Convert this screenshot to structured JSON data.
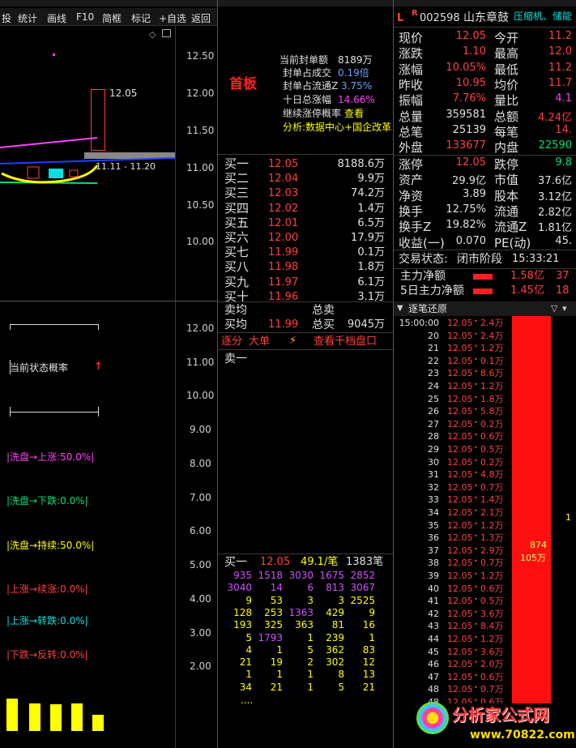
{
  "toolbar": {
    "items": [
      "投",
      "统计",
      "画线",
      "F10",
      "简框",
      "标记",
      "+自选",
      "返回"
    ]
  },
  "chart_top": {
    "y_ticks": [
      "12.50",
      "12.00",
      "11.50",
      "11.00",
      "10.50",
      "10.00"
    ],
    "price_label": "12.05",
    "range_label": "11.11 - 11.20"
  },
  "chart_bottom": {
    "y_ticks": [
      "12.00",
      "11.00",
      "10.00",
      "9.00",
      "8.00",
      "7.00",
      "6.00",
      "5.00",
      "4.00",
      "3.00",
      "2.00"
    ],
    "status_title": "当前状态概率",
    "arrow": "↑",
    "probs": [
      {
        "text": "|洗盘→上涨:50.0%|",
        "color": "#ff40ff"
      },
      {
        "text": "|洗盘→下跌:0.0%|",
        "color": "#00e070"
      },
      {
        "text": "|洗盘→持续:50.0%|",
        "color": "#ffff00"
      },
      {
        "text": "|上涨→续涨:0.0%|",
        "color": "#ff4040"
      },
      {
        "text": "|上涨→转跌:0.0%|",
        "color": "#00e0e0"
      },
      {
        "text": "|下跌→反转:0.0%|",
        "color": "#ff4040"
      }
    ]
  },
  "info": {
    "lines": [
      {
        "k": "当前封单额",
        "v": "8189万",
        "vc": "#e0e0e0"
      },
      {
        "k": "封单占成交",
        "v": "0.19倍",
        "vc": "#6ca0ff"
      },
      {
        "k": "封单占流通Z",
        "v": "3.75%",
        "vc": "#6ca0ff"
      },
      {
        "k": "十日总涨幅",
        "v": "14.66%",
        "vc": "#ff40ff"
      },
      {
        "k": "继续涨停概率",
        "v": "查看",
        "vc": "#ffff00"
      }
    ],
    "analysis": "分析:数据中心+国企改革",
    "badge": "首板"
  },
  "orderbook": {
    "bids": [
      [
        "买一",
        "12.05",
        "8188.6万"
      ],
      [
        "买二",
        "12.04",
        "9.9万"
      ],
      [
        "买三",
        "12.03",
        "74.2万"
      ],
      [
        "买四",
        "12.02",
        "1.4万"
      ],
      [
        "买五",
        "12.01",
        "6.5万"
      ],
      [
        "买六",
        "12.00",
        "17.9万"
      ],
      [
        "买七",
        "11.99",
        "0.1万"
      ],
      [
        "买八",
        "11.98",
        "1.8万"
      ],
      [
        "买九",
        "11.97",
        "6.1万"
      ],
      [
        "买十",
        "11.96",
        "3.1万"
      ]
    ],
    "avg_sell_label": "卖均",
    "avg_buy_label": "买均",
    "avg_buy": "11.99",
    "total_sell_label": "总卖",
    "total_buy_label": "总买",
    "total_buy": "9045万",
    "tabs": [
      "逐分",
      "大单",
      "查看千档盘口"
    ],
    "sell1": "卖一",
    "queue_header": {
      "label": "买一",
      "price": "12.05",
      "avg": "49.1/笔",
      "count": "1383笔"
    },
    "queue": [
      [
        "935",
        "1518",
        "3030",
        "1675",
        "2852"
      ],
      [
        "3040",
        "14",
        "6",
        "813",
        "3067"
      ],
      [
        "9",
        "53",
        "3",
        "3",
        "2525"
      ],
      [
        "128",
        "253",
        "1363",
        "429",
        "9"
      ],
      [
        "193",
        "325",
        "363",
        "81",
        "16"
      ],
      [
        "5",
        "1793",
        "1",
        "239",
        "1"
      ],
      [
        "4",
        "1",
        "5",
        "362",
        "83"
      ],
      [
        "21",
        "19",
        "2",
        "302",
        "12"
      ],
      [
        "1",
        "1",
        "1",
        "8",
        "13"
      ],
      [
        "34",
        "21",
        "1",
        "5",
        "21"
      ]
    ],
    "queue_more": "...."
  },
  "quote": {
    "header": {
      "flag_l": "L",
      "flag_r": "R",
      "code": "002598",
      "name": "山东章鼓",
      "tags": "压缩机、储能"
    },
    "rows": [
      [
        "现价",
        "12.05",
        "今开",
        "11.2"
      ],
      [
        "涨跌",
        "1.10",
        "最高",
        "12.0"
      ],
      [
        "涨幅",
        "10.05%",
        "最低",
        "11.2"
      ],
      [
        "昨收",
        "10.95",
        "均价",
        "11.7"
      ],
      [
        "振幅",
        "7.76%",
        "量比",
        "4.1"
      ],
      [
        "总量",
        "359581",
        "总额",
        "4.24亿"
      ],
      [
        "总笔",
        "25139",
        "每笔",
        "14."
      ],
      [
        "外盘",
        "133677",
        "内盘",
        "22590"
      ]
    ],
    "rows2": [
      [
        "涨停",
        "12.05",
        "跌停",
        "9.8"
      ],
      [
        "资产",
        "29.9亿",
        "市值",
        "37.6亿"
      ],
      [
        "净资",
        "3.89",
        "股本",
        "3.12亿"
      ],
      [
        "换手",
        "12.75%",
        "流通",
        "2.82亿"
      ],
      [
        "换手Z",
        "19.82%",
        "流通Z",
        "1.81亿"
      ],
      [
        "收益(一)",
        "0.070",
        "PE(动)",
        "45."
      ]
    ],
    "status_label": "交易状态:",
    "status": "闭市阶段",
    "time": "15:33:21",
    "flows": [
      {
        "label": "主力净额",
        "value": "1.58亿",
        "extra": "37"
      },
      {
        "label": "5日主力净额",
        "value": "1.45亿",
        "extra": "18"
      }
    ]
  },
  "ticks": {
    "title": "逐笔还原",
    "rows": [
      [
        "15:00:00",
        "12.05",
        "2.4万"
      ],
      [
        "20",
        "12.05",
        "2.4万"
      ],
      [
        "21",
        "12.05",
        "1.2万"
      ],
      [
        "22",
        "12.05",
        "0.1万"
      ],
      [
        "23",
        "12.05",
        "8.6万"
      ],
      [
        "24",
        "12.05",
        "1.2万"
      ],
      [
        "25",
        "12.05",
        "1.8万"
      ],
      [
        "26",
        "12.05",
        "5.8万"
      ],
      [
        "27",
        "12.05",
        "0.2万"
      ],
      [
        "28",
        "12.05",
        "0.6万"
      ],
      [
        "29",
        "12.05",
        "0.5万"
      ],
      [
        "30",
        "12.05",
        "0.2万"
      ],
      [
        "31",
        "12.05",
        "4.8万"
      ],
      [
        "32",
        "12.05",
        "0.7万"
      ],
      [
        "33",
        "12.05",
        "1.4万"
      ],
      [
        "34",
        "12.05",
        "2.1万"
      ],
      [
        "35",
        "12.05",
        "1.2万"
      ],
      [
        "36",
        "12.05",
        "1.3万"
      ],
      [
        "37",
        "12.05",
        "2.9万"
      ],
      [
        "38",
        "12.05",
        "0.7万"
      ],
      [
        "39",
        "12.05",
        "1.2万"
      ],
      [
        "40",
        "12.05",
        "0.6万"
      ],
      [
        "41",
        "12.05",
        "0.5万"
      ],
      [
        "42",
        "12.05",
        "3.6万"
      ],
      [
        "43",
        "12.05",
        "8.4万"
      ],
      [
        "44",
        "12.05",
        "1.2万"
      ],
      [
        "45",
        "12.05",
        "3.6万"
      ],
      [
        "46",
        "12.05",
        "2.0万"
      ],
      [
        "47",
        "12.05",
        "0.6万"
      ],
      [
        "48",
        "12.05",
        "0.7万"
      ],
      [
        "48",
        "12.05",
        "0.6万"
      ]
    ],
    "bar_vals": [
      "874",
      "105万"
    ],
    "side": "1"
  },
  "watermark": {
    "text": "分析家公式网",
    "url": "www.70822.com"
  }
}
